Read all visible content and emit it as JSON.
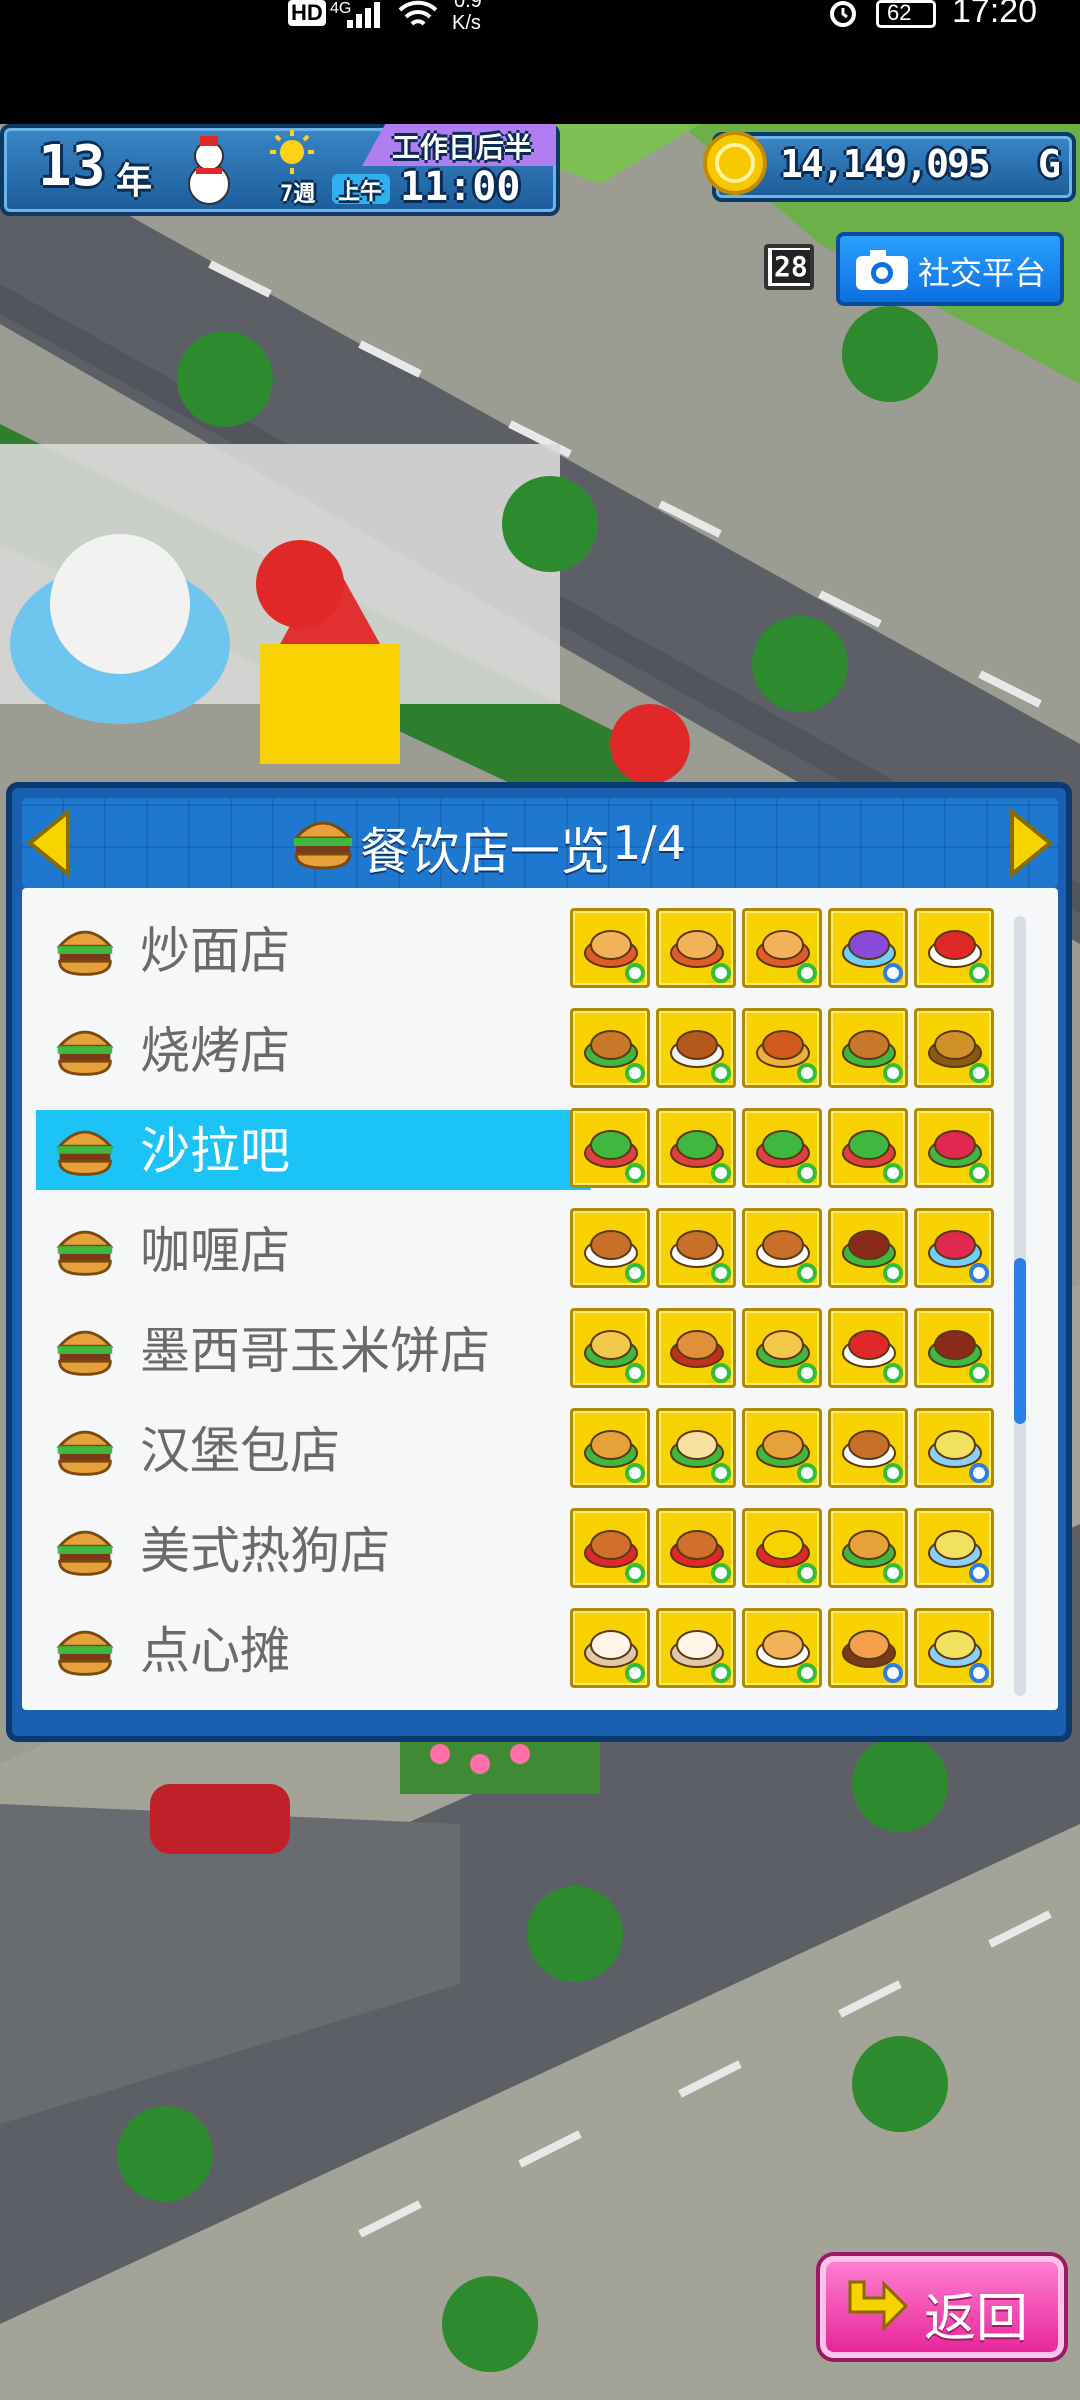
{
  "status_bar": {
    "hd_badge": "HD",
    "network": "4G",
    "speed_value": "0.9",
    "speed_unit": "K/s",
    "battery": "62",
    "time": "17:20"
  },
  "hud": {
    "year_number": "13",
    "year_unit": "年",
    "weather_icon": "sun-icon",
    "date_label": "7週",
    "period_tag": "工作日后半",
    "am_pm": "上午",
    "clock": "11:00",
    "money": "14,149,095",
    "currency": "G",
    "calendar_day": "28",
    "social_label": "社交平台"
  },
  "list": {
    "title": "餐饮店一览",
    "page": "1/4",
    "selected_index": 2,
    "rows": [
      {
        "label": "炒面店",
        "items": [
          {
            "icon": "noodles-icon",
            "badge": "green"
          },
          {
            "icon": "noodles-icon",
            "badge": "green"
          },
          {
            "icon": "noodles-icon",
            "badge": "green"
          },
          {
            "icon": "grape-drink-icon",
            "badge": "blue"
          },
          {
            "icon": "soda-can-icon",
            "badge": "green"
          }
        ]
      },
      {
        "label": "烧烤店",
        "items": [
          {
            "icon": "skewer-icon",
            "badge": "green"
          },
          {
            "icon": "meat-icon",
            "badge": "green"
          },
          {
            "icon": "sausage-skewer-icon",
            "badge": "green"
          },
          {
            "icon": "skewer-icon",
            "badge": "green"
          },
          {
            "icon": "fish-icon",
            "badge": "green"
          }
        ]
      },
      {
        "label": "沙拉吧",
        "items": [
          {
            "icon": "salad-icon",
            "badge": "green"
          },
          {
            "icon": "salad-icon",
            "badge": "green"
          },
          {
            "icon": "salad-icon",
            "badge": "green"
          },
          {
            "icon": "salad-icon",
            "badge": "green"
          },
          {
            "icon": "fruit-salad-icon",
            "badge": "green"
          }
        ]
      },
      {
        "label": "咖喱店",
        "items": [
          {
            "icon": "curry-icon",
            "badge": "green"
          },
          {
            "icon": "curry-icon",
            "badge": "green"
          },
          {
            "icon": "curry-icon",
            "badge": "green"
          },
          {
            "icon": "steak-icon",
            "badge": "green"
          },
          {
            "icon": "parfait-icon",
            "badge": "blue"
          }
        ]
      },
      {
        "label": "墨西哥玉米饼店",
        "items": [
          {
            "icon": "taco-icon",
            "badge": "green"
          },
          {
            "icon": "burrito-icon",
            "badge": "green"
          },
          {
            "icon": "taco-icon",
            "badge": "green"
          },
          {
            "icon": "soda-can-icon",
            "badge": "green"
          },
          {
            "icon": "steak-icon",
            "badge": "green"
          }
        ]
      },
      {
        "label": "汉堡包店",
        "items": [
          {
            "icon": "burger-icon",
            "badge": "green"
          },
          {
            "icon": "sandwich-icon",
            "badge": "green"
          },
          {
            "icon": "burger-icon",
            "badge": "green"
          },
          {
            "icon": "drumstick-icon",
            "badge": "green"
          },
          {
            "icon": "juice-icon",
            "badge": "blue"
          }
        ]
      },
      {
        "label": "美式热狗店",
        "items": [
          {
            "icon": "corndog-icon",
            "badge": "green"
          },
          {
            "icon": "corndog-icon",
            "badge": "green"
          },
          {
            "icon": "fries-icon",
            "badge": "green"
          },
          {
            "icon": "burger-icon",
            "badge": "green"
          },
          {
            "icon": "juice-icon",
            "badge": "blue"
          }
        ]
      },
      {
        "label": "点心摊",
        "items": [
          {
            "icon": "bun-icon",
            "badge": "green"
          },
          {
            "icon": "bun-icon",
            "badge": "green"
          },
          {
            "icon": "dim-sum-icon",
            "badge": "green"
          },
          {
            "icon": "bao-icon",
            "badge": "blue"
          },
          {
            "icon": "juice-icon",
            "badge": "blue"
          }
        ]
      }
    ]
  },
  "back_button": {
    "label": "返回"
  },
  "colors": {
    "panel_blue": "#1a5fb0",
    "highlight": "#1bc3f6",
    "item_yellow": "#f7d100",
    "badge_green": "#2fbf3a",
    "badge_blue": "#2a7ee8",
    "back_pink": "#ff4fb8"
  }
}
